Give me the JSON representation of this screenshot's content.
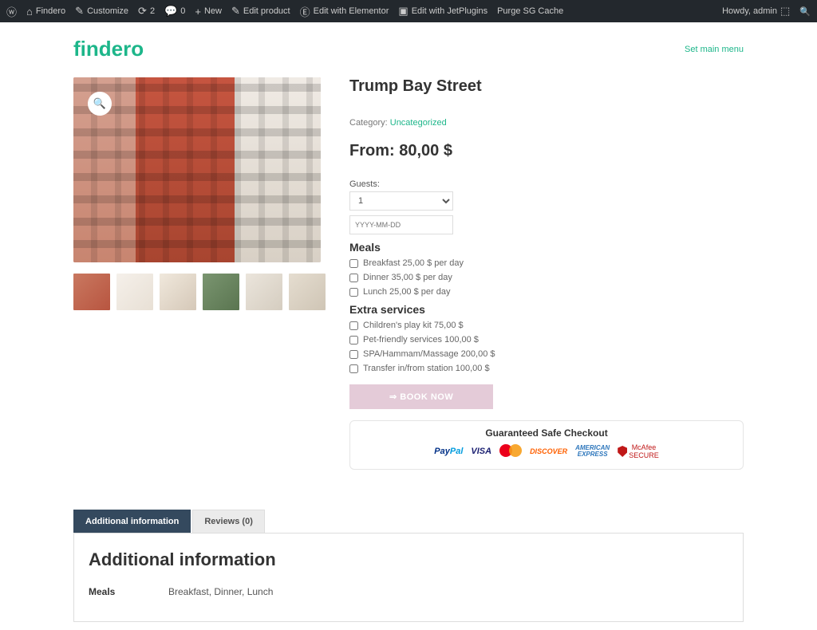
{
  "admin_bar": {
    "site_name": "Findero",
    "customize": "Customize",
    "updates_count": "2",
    "comments_count": "0",
    "new": "New",
    "edit_product": "Edit product",
    "edit_elementor": "Edit with Elementor",
    "edit_jetplugins": "Edit with JetPlugins",
    "purge_cache": "Purge SG Cache",
    "howdy": "Howdy, admin"
  },
  "header": {
    "logo": "findero",
    "menu_link": "Set main menu"
  },
  "product": {
    "title": "Trump Bay Street",
    "category_label": "Category: ",
    "category_link": "Uncategorized",
    "price_prefix": "From: ",
    "price": "80,00 $",
    "guests_label": "Guests:",
    "guests_value": "1",
    "date_placeholder": "YYYY-MM-DD",
    "meals_title": "Meals",
    "meals": [
      {
        "label": "Breakfast 25,00 $ per day"
      },
      {
        "label": "Dinner 35,00 $ per day"
      },
      {
        "label": "Lunch 25,00 $ per day"
      }
    ],
    "extras_title": "Extra services",
    "extras": [
      {
        "label": "Children's play kit 75,00 $"
      },
      {
        "label": "Pet-friendly services 100,00 $"
      },
      {
        "label": "SPA/Hammam/Massage 200,00 $"
      },
      {
        "label": "Transfer in/from station 100,00 $"
      }
    ],
    "book_button": "⇒ BOOK NOW",
    "checkout_title": "Guaranteed Safe Checkout"
  },
  "tabs": {
    "additional": "Additional information",
    "reviews": "Reviews (0)",
    "heading": "Additional information",
    "rows": [
      {
        "label": "Meals",
        "value": "Breakfast, Dinner, Lunch"
      }
    ]
  }
}
